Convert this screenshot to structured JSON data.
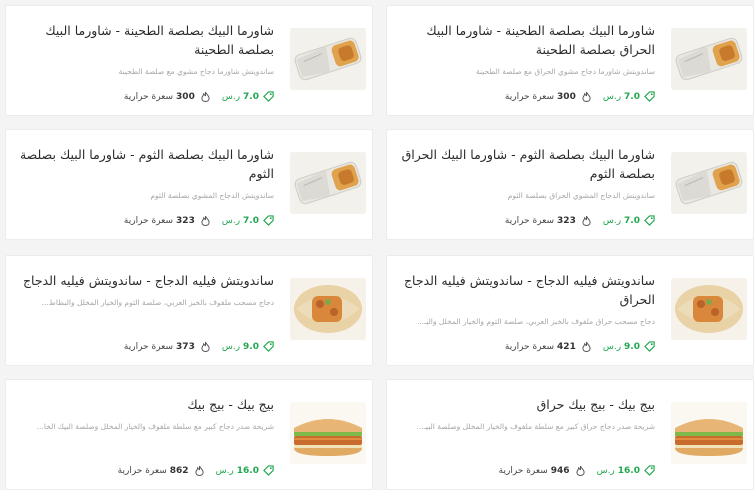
{
  "colors": {
    "price_green": "#20a84f",
    "text_dark": "#2b2b2b",
    "desc_gray": "#a6a6a6"
  },
  "icons": {
    "price": "price-tag-icon",
    "calories": "flame-icon"
  },
  "cards": [
    {
      "title": "شاورما البيك بصلصة الطحينة - شاورما البيك الحراق بصلصة الطحينة",
      "description": "ساندويتش شاورما دجاج مشوي الحراق مع صلصة الطحينة",
      "price": "7.0",
      "currency": "ر.س",
      "calories": "300",
      "calories_unit": "سعرة حرارية",
      "image": "shawarma-wrap-image"
    },
    {
      "title": "شاورما البيك بصلصة الطحينة - شاورما البيك بصلصة الطحينة",
      "description": "ساندويتش شاورما دجاج مشوي مع صلصة الطحينة",
      "price": "7.0",
      "currency": "ر.س",
      "calories": "300",
      "calories_unit": "سعرة حرارية",
      "image": "shawarma-wrap-image"
    },
    {
      "title": "شاورما البيك بصلصة الثوم - شاورما البيك الحراق بصلصة الثوم",
      "description": "ساندويتش الدجاج المشوي الحراق بصلصة الثوم",
      "price": "7.0",
      "currency": "ر.س",
      "calories": "323",
      "calories_unit": "سعرة حرارية",
      "image": "shawarma-wrap-image"
    },
    {
      "title": "شاورما البيك بصلصة الثوم - شاورما البيك بصلصة الثوم",
      "description": "ساندويتش الدجاج المشوي بصلصة الثوم",
      "price": "7.0",
      "currency": "ر.س",
      "calories": "323",
      "calories_unit": "سعرة حرارية",
      "image": "shawarma-wrap-image"
    },
    {
      "title": "ساندويتش فيليه الدجاج - ساندويتش فيليه الدجاج الحراق",
      "description": "دجاج مسحب حراق ملفوف بالخبز العربي، صلصة الثوم والخيار المخلل والبـ...",
      "price": "9.0",
      "currency": "ر.س",
      "calories": "421",
      "calories_unit": "سعرة حرارية",
      "image": "chicken-fillet-wrap-image"
    },
    {
      "title": "ساندويتش فيليه الدجاج - ساندويتش فيليه الدجاج",
      "description": "دجاج مسحب ملفوف بالخبز العربي، صلصة الثوم والخيار المخلل والبطاط...",
      "price": "9.0",
      "currency": "ر.س",
      "calories": "373",
      "calories_unit": "سعرة حرارية",
      "image": "chicken-fillet-wrap-image"
    },
    {
      "title": "بيج بيك - بيج بيك حراق",
      "description": "شريحة صدر دجاج حراق كبير مع سلطة ملفوف والخيار المخلل وصلصة البيـ...",
      "price": "16.0",
      "currency": "ر.س",
      "calories": "946",
      "calories_unit": "سعرة حرارية",
      "image": "chicken-burger-image"
    },
    {
      "title": "بيج بيك - بيج بيك",
      "description": "شريحة صدر دجاج كبير مع سلطة ملفوف والخيار المخلل وصلصة البيك الخا...",
      "price": "16.0",
      "currency": "ر.س",
      "calories": "862",
      "calories_unit": "سعرة حرارية",
      "image": "chicken-burger-image"
    }
  ]
}
